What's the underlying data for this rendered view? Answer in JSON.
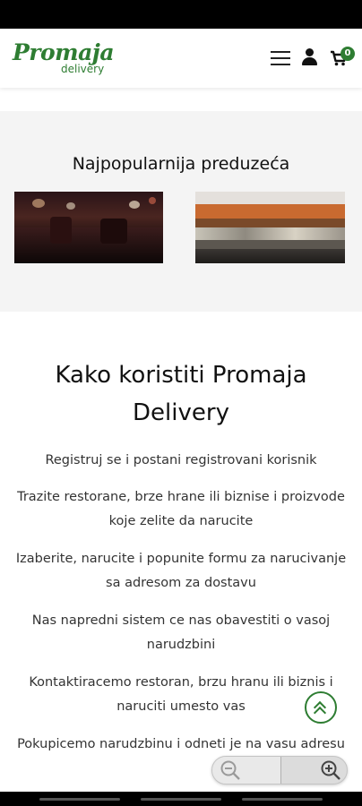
{
  "colors": {
    "brand_green": "#2e7d32",
    "section_bg": "#f4f4f4",
    "text": "#333333"
  },
  "header": {
    "logo_main": "Promaja",
    "logo_sub": "delivery",
    "menu_icon": "hamburger-menu-icon",
    "user_icon": "user-icon",
    "cart_icon": "cart-icon",
    "cart_count": "0"
  },
  "popular": {
    "title": "Najpopularnija preduzeća",
    "images": [
      {
        "icon": "restaurant-interior-image"
      },
      {
        "icon": "food-counter-image"
      }
    ]
  },
  "how": {
    "title": "Kako koristiti Promaja Delivery",
    "steps": [
      "Registruj se i postani registrovani korisnik",
      "Trazite restorane, brze hrane ili biznise i proizvode koje zelite da narucite",
      "Izaberite, narucite i popunite formu za narucivanje sa adresom za dostavu",
      "Nas napredni sistem ce nas obavestiti o vasoj narudzbini",
      "Kontaktiracemo restoran, brzu hranu ili biznis i naruciti umesto vas",
      "Pokupicemo narudzbinu i odneti je na vasu adresu"
    ]
  },
  "controls": {
    "scroll_top_icon": "double-chevron-up-icon",
    "zoom_out_icon": "zoom-out-icon",
    "zoom_in_icon": "zoom-in-icon"
  }
}
